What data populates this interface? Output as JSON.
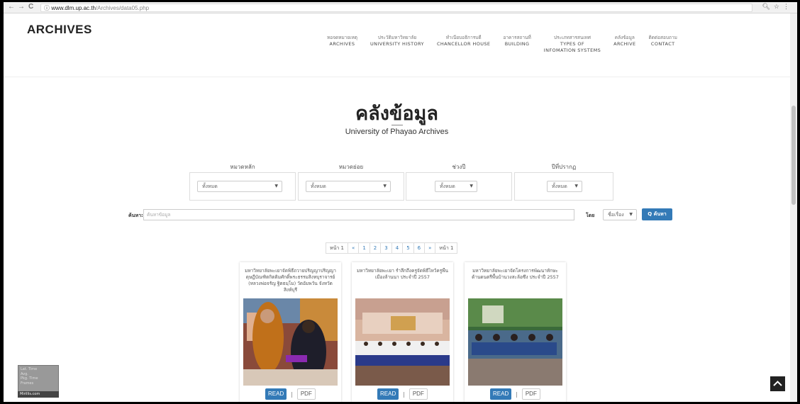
{
  "browser": {
    "url_host": "www.dlm.up.ac.th",
    "url_path": "/Archives/data05.php",
    "back_glyph": "←",
    "forward_glyph": "→",
    "reload_glyph": "C",
    "secure_glyph": "ⓘ",
    "right_icons": "🔍︎☆⋮"
  },
  "header": {
    "logo": "ARCHIVES",
    "menu": [
      {
        "th": "หอจดหมายเหตุ",
        "en": "ARCHIVES"
      },
      {
        "th": "ประวัติมหาวิทยาลัย",
        "en": "UNIVERSITY HISTORY"
      },
      {
        "th": "ทำเนียบอธิการบดี",
        "en": "CHANCELLOR HOUSE"
      },
      {
        "th": "อาคารสถานที่",
        "en": "BUILDING"
      },
      {
        "th": "ประเภทสารสนเทศ",
        "en": "TYPES OF",
        "en2": "INFOMATION SYSTEMS"
      },
      {
        "th": "คลังข้อมูล",
        "en": "ARCHIVE"
      },
      {
        "th": "ติดต่อสอบถาม",
        "en": "CONTACT"
      }
    ]
  },
  "main": {
    "title": "คลังข้อมูล",
    "subtitle": "University of Phayao Archives"
  },
  "filters": [
    {
      "label": "หมวดหลัก",
      "value": "ทั้งหมด"
    },
    {
      "label": "หมวดย่อย",
      "value": "ทั้งหมด"
    },
    {
      "label": "ช่วงปี",
      "value": "ทั้งหมด"
    },
    {
      "label": "ปีที่ปรากฏ",
      "value": "ทั้งหมด"
    }
  ],
  "search": {
    "label": "ค้นหา:",
    "placeholder": "ค้นหาข้อมูล",
    "by_label": "โดย",
    "by_value": "ชื่อเรื่อง",
    "button": "Q ค้นหา"
  },
  "pager": {
    "prefix": "หน้า 1",
    "prev": "«",
    "pages": [
      "1",
      "2",
      "3",
      "4",
      "5",
      "6"
    ],
    "next": "»",
    "suffix": "หน้า 1"
  },
  "cards": [
    {
      "title": "มหาวิทยาลัยพะเยาจัดพิธีถวายปริญญาปริญญาดุษฎีบัณฑิตกิตติมศักดิ์พระธรรมสิงหบุราจารย์ (หลวงพ่อจรัญ ฐิตธมฺโม) วัดอัมพวัน จังหวัดสิงห์บุรี",
      "read": "READ",
      "sep": "|",
      "pdf": "PDF"
    },
    {
      "title": "มหาวิทยาลัยพะเยา รำลึกถึงครูจัดพิธีไหว้ครูพื้นเมืองล้านนา ประจำปี 2557",
      "read": "READ",
      "sep": "|",
      "pdf": "PDF"
    },
    {
      "title": "มหาวิทยาลัยพะเยาจัดโครงการพัฒนาทักษะด้านดนตรีพื้นบ้านวงสะล้อซึง ประจำปี 2557",
      "read": "READ",
      "sep": "|",
      "pdf": "PDF"
    }
  ],
  "hud": {
    "lines": [
      "Lat. Time",
      "Avg.",
      "Pkg. Time",
      "Frames"
    ],
    "brand": "Mirillis.com"
  },
  "to_top_glyph": "⌃",
  "colors": {
    "primary": "#337ab7"
  }
}
